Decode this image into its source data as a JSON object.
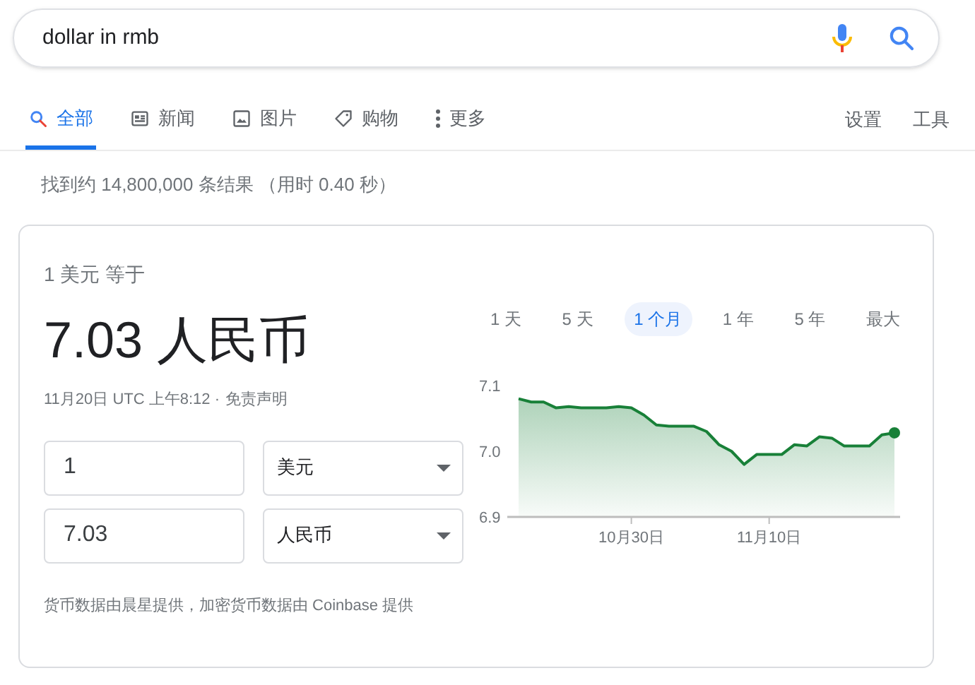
{
  "search": {
    "value": "dollar in rmb"
  },
  "tabs": [
    {
      "label": "全部",
      "kind": "all",
      "selected": true
    },
    {
      "label": "新闻",
      "kind": "news",
      "selected": false
    },
    {
      "label": "图片",
      "kind": "images",
      "selected": false
    },
    {
      "label": "购物",
      "kind": "shopping",
      "selected": false
    },
    {
      "label": "更多",
      "kind": "more",
      "selected": false
    }
  ],
  "tools": [
    "设置",
    "工具"
  ],
  "result_stats": "找到约 14,800,000 条结果 （用时 0.40 秒）",
  "card": {
    "heading": "1 美元 等于",
    "result": "7.03 人民币",
    "timestamp": "11月20日 UTC 上午8:12 ·",
    "disclaimer": "免责声明",
    "converter": [
      {
        "amount": "1",
        "currency": "美元"
      },
      {
        "amount": "7.03",
        "currency": "人民币"
      }
    ],
    "source": "货币数据由晨星提供，加密货币数据由 Coinbase 提供",
    "ranges": [
      {
        "label": "1 天",
        "selected": false
      },
      {
        "label": "5 天",
        "selected": false
      },
      {
        "label": "1 个月",
        "selected": true
      },
      {
        "label": "1 年",
        "selected": false
      },
      {
        "label": "5 年",
        "selected": false
      },
      {
        "label": "最大",
        "selected": false
      }
    ],
    "chart_data": {
      "type": "area",
      "categories": [
        null,
        null,
        null,
        null,
        null,
        null,
        null,
        null,
        null,
        "10月30日",
        null,
        null,
        null,
        null,
        null,
        null,
        null,
        null,
        null,
        null,
        "11月10日",
        null,
        null,
        null,
        null,
        null,
        null,
        null,
        null,
        null,
        null
      ],
      "series": [
        {
          "color": "#188038",
          "values": [
            7.08,
            7.075,
            7.075,
            7.066,
            7.068,
            7.066,
            7.066,
            7.066,
            7.068,
            7.066,
            7.055,
            7.04,
            7.038,
            7.038,
            7.038,
            7.03,
            7.01,
            7.0,
            6.98,
            6.995,
            6.995,
            6.995,
            7.01,
            7.008,
            7.022,
            7.02,
            7.008,
            7.008,
            7.008,
            7.025,
            7.028
          ]
        }
      ],
      "ylim": [
        6.9,
        7.1
      ],
      "yticks": [
        {
          "value": 7.1,
          "label": "7.1"
        },
        {
          "value": 7.0,
          "label": "7.0"
        },
        {
          "value": 6.9,
          "label": "6.9"
        }
      ]
    }
  }
}
